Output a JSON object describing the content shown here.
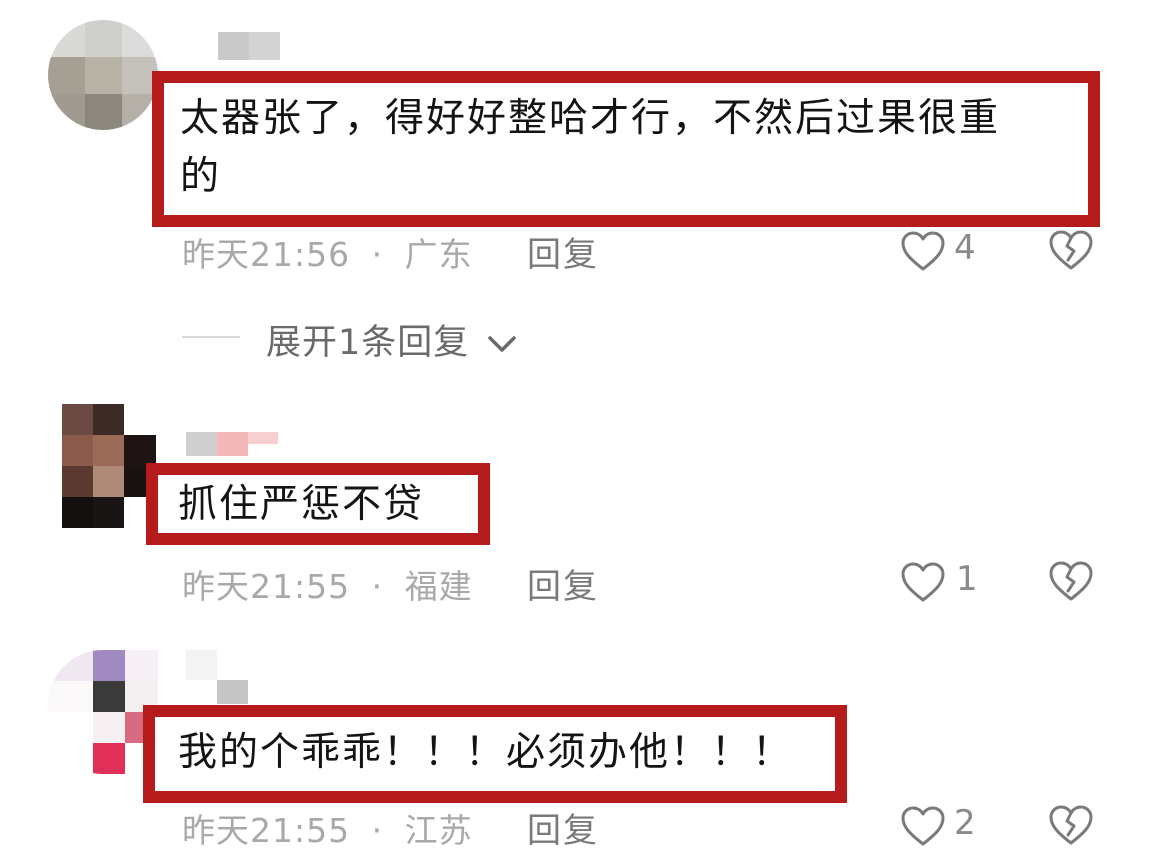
{
  "comments": [
    {
      "text": "太器张了，得好好整哈才行，不然后过果很重的",
      "text_line1": "太器张了，得好好整哈才行，不然后过果很重",
      "text_line2": "的",
      "time": "昨天21:56",
      "location": "广东",
      "reply_label": "回复",
      "likes": "4",
      "expand_label": "展开1条回复"
    },
    {
      "text": "抓住严惩不贷",
      "time": "昨天21:55",
      "location": "福建",
      "reply_label": "回复",
      "likes": "1"
    },
    {
      "text": "我的个乖乖！！！必须办他！！！",
      "time": "昨天21:55",
      "location": "江苏",
      "reply_label": "回复",
      "likes": "2"
    }
  ],
  "meta_separator": "·",
  "colors": {
    "highlight_border": "#b61b1b",
    "meta_text": "#a9a9a9",
    "icon_stroke": "#7a7a7a"
  },
  "icons": [
    "heart-outline-icon",
    "broken-heart-icon",
    "chevron-down-icon"
  ]
}
